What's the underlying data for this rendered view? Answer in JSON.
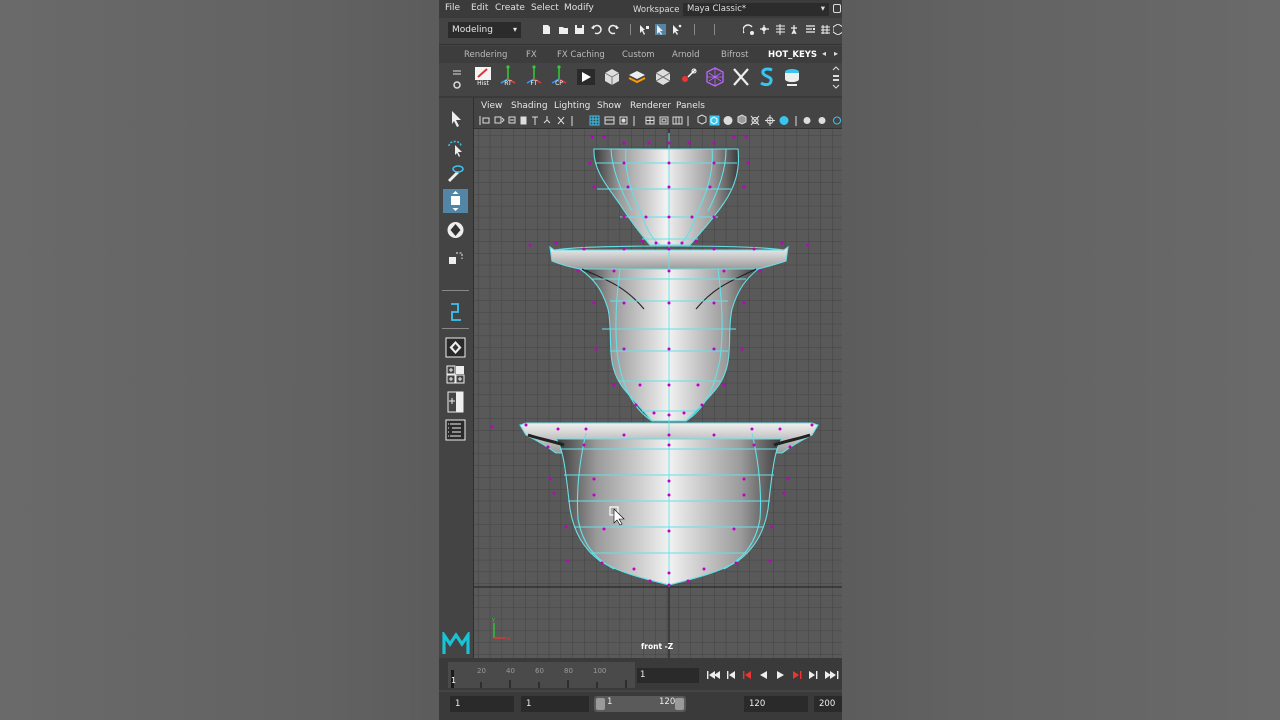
{
  "menubar": {
    "items": [
      "File",
      "Edit",
      "Create",
      "Select",
      "Modify"
    ],
    "workspace_label": "Workspace :",
    "workspace_value": "Maya Classic*"
  },
  "statusline": {
    "mode": "Modeling"
  },
  "shelf": {
    "tabs": [
      "Rendering",
      "FX",
      "FX Caching",
      "Custom",
      "Arnold",
      "Bifrost",
      "HOT_KEYS"
    ],
    "active_tab": "HOT_KEYS",
    "buttons": [
      {
        "label": "Hist",
        "icon": "history-icon"
      },
      {
        "label": "RT",
        "icon": "reset-transform-icon"
      },
      {
        "label": "FT",
        "icon": "freeze-transform-icon"
      },
      {
        "label": "CP",
        "icon": "center-pivot-icon"
      },
      {
        "label": "",
        "icon": "render-icon"
      },
      {
        "label": "",
        "icon": "cube-icon"
      },
      {
        "label": "",
        "icon": "combine-icon"
      },
      {
        "label": "",
        "icon": "separate-icon"
      },
      {
        "label": "",
        "icon": "pivot-icon"
      },
      {
        "label": "",
        "icon": "lattice-icon"
      },
      {
        "label": "",
        "icon": "tools-icon"
      },
      {
        "label": "",
        "icon": "maya-s-icon"
      },
      {
        "label": "",
        "icon": "bucket-icon"
      }
    ]
  },
  "panel": {
    "menus": [
      "View",
      "Shading",
      "Lighting",
      "Show",
      "Renderer",
      "Panels"
    ],
    "camera_label": "front -Z"
  },
  "timeslider": {
    "tick_labels": [
      "20",
      "40",
      "60",
      "80",
      "100"
    ],
    "start_label": "1",
    "current_frame": "1"
  },
  "range": {
    "anim_start": "1",
    "playback_start": "1",
    "range_start": "1",
    "range_end": "120",
    "playback_end": "120",
    "anim_end": "200"
  },
  "colors": {
    "wire": "#66e0e6",
    "cv": "#c000c8",
    "active_tool": "#5285a6"
  }
}
